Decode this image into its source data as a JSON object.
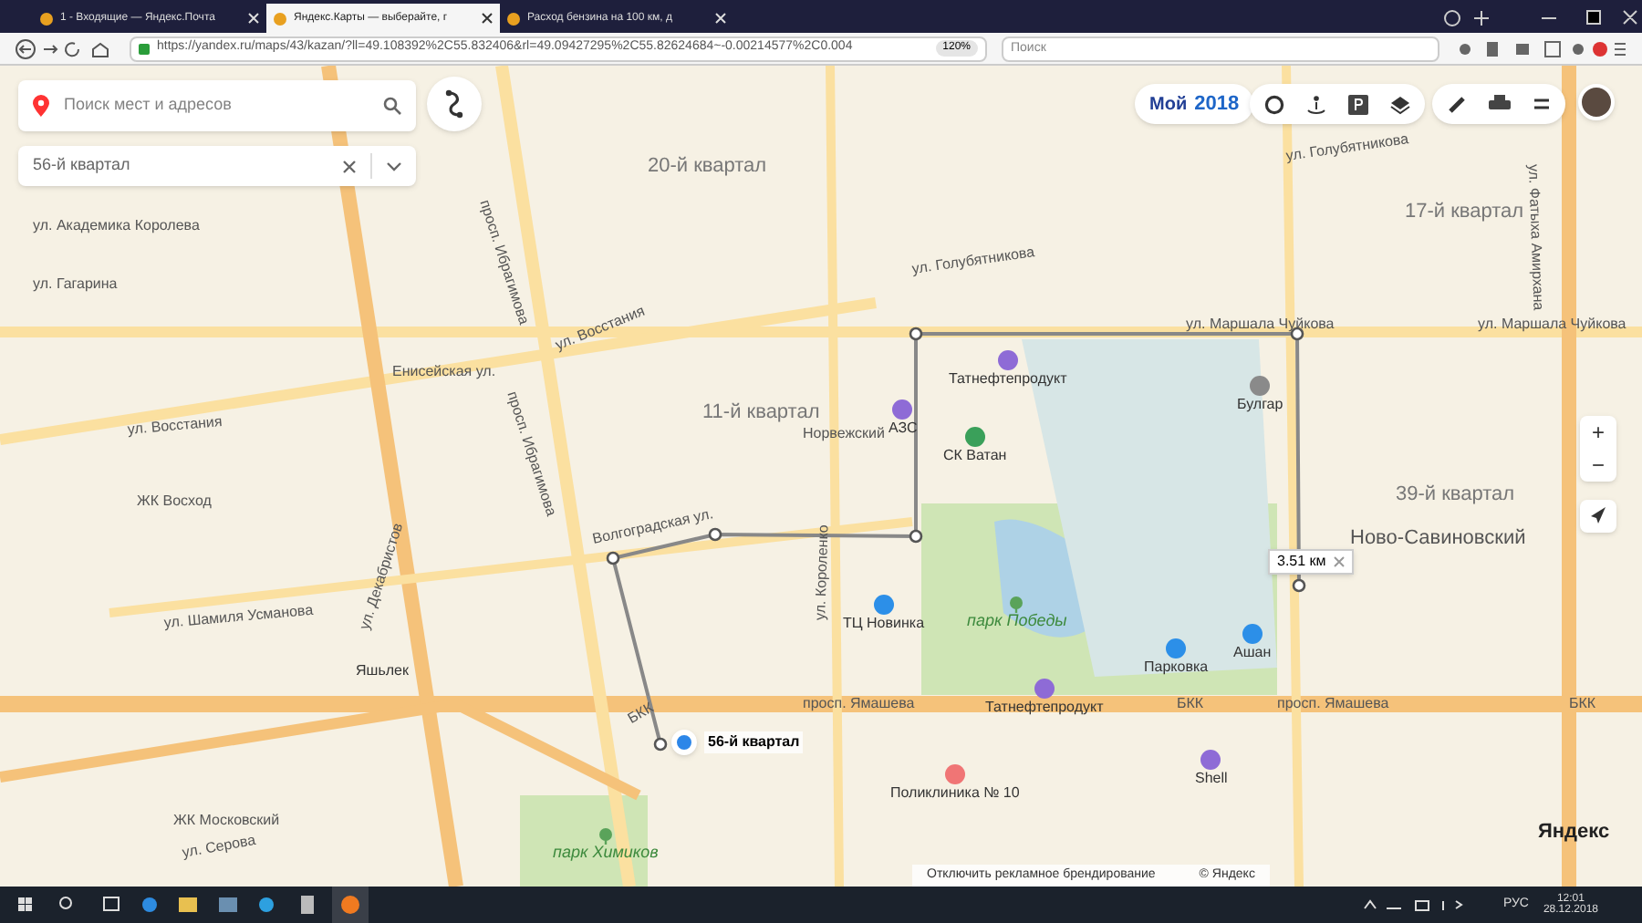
{
  "browser": {
    "tabs": [
      {
        "label": "1 - Входящие — Яндекс.Почта",
        "selected": false
      },
      {
        "label": "Яндекс.Карты — выберайте, г",
        "selected": true
      },
      {
        "label": "Расход бензина на 100 км, д",
        "selected": false
      }
    ],
    "url": "https://yandex.ru/maps/43/kazan/?ll=49.108392%2C55.832406&rl=49.09427295%2C55.82624684~-0.00214577%2C0.004",
    "zoom": "120%",
    "search_placeholder": "Поиск"
  },
  "map": {
    "search": {
      "placeholder": "Поиск мест и адресов"
    },
    "route_field": {
      "value": "56-й квартал"
    },
    "promo": {
      "word": "Мой",
      "year": "2018"
    },
    "labels": [
      {
        "text": "20-й квартал",
        "kind": "district"
      },
      {
        "text": "17-й квартал",
        "kind": "district"
      },
      {
        "text": "ул. Академика Королева",
        "kind": "street"
      },
      {
        "text": "ул. Голубятникова",
        "kind": "street"
      },
      {
        "text": "ул. Голубятникова",
        "kind": "street"
      },
      {
        "text": "ул. Гагарина",
        "kind": "street"
      },
      {
        "text": "ул. Маршала Чуйкова",
        "kind": "street"
      },
      {
        "text": "ул. Маршала Чуйкова",
        "kind": "street"
      },
      {
        "text": "ул. Восстания",
        "kind": "street"
      },
      {
        "text": "ул. Восстания",
        "kind": "street"
      },
      {
        "text": "Енисейская ул.",
        "kind": "street"
      },
      {
        "text": "11-й квартал",
        "kind": "district"
      },
      {
        "text": "Норвежский",
        "kind": "street"
      },
      {
        "text": "39-й квартал",
        "kind": "district"
      },
      {
        "text": "Ново-Савиновский",
        "kind": "area"
      },
      {
        "text": "Волгоградская ул.",
        "kind": "street"
      },
      {
        "text": "ЖК Восход",
        "kind": "street"
      },
      {
        "text": "ул. Шамиля Усманова",
        "kind": "street"
      },
      {
        "text": "ул. Декабристов",
        "kind": "street"
      },
      {
        "text": "просп. Ибрагимова",
        "kind": "street"
      },
      {
        "text": "просп. Ибрагимова",
        "kind": "street"
      },
      {
        "text": "ул. Короленко",
        "kind": "street"
      },
      {
        "text": "ул. Фатыха Амирхана",
        "kind": "street"
      },
      {
        "text": "просп. Ямашева",
        "kind": "street"
      },
      {
        "text": "БКК",
        "kind": "street"
      },
      {
        "text": "просп. Ямашева",
        "kind": "street"
      },
      {
        "text": "БКК",
        "kind": "street"
      },
      {
        "text": "БКК",
        "kind": "street"
      },
      {
        "text": "ЖК Московский",
        "kind": "street"
      },
      {
        "text": "ул. Серова",
        "kind": "street"
      },
      {
        "text": "Татнефтепродукт",
        "kind": "poi"
      },
      {
        "text": "АЗС",
        "kind": "poi"
      },
      {
        "text": "СК Ватан",
        "kind": "poi"
      },
      {
        "text": "Булгар",
        "kind": "poi"
      },
      {
        "text": "ТЦ Новинка",
        "kind": "poi"
      },
      {
        "text": "Татнефтепродукт",
        "kind": "poi"
      },
      {
        "text": "Парковка",
        "kind": "poi"
      },
      {
        "text": "Ашан",
        "kind": "poi"
      },
      {
        "text": "Shell",
        "kind": "poi"
      },
      {
        "text": "Поликлиника № 10",
        "kind": "poi"
      },
      {
        "text": "Яшьлек",
        "kind": "poi"
      },
      {
        "text": "парк Победы",
        "kind": "park"
      },
      {
        "text": "парк Химиков",
        "kind": "park"
      }
    ],
    "distance": "3.51 км",
    "route_point": "56-й квартал",
    "zoom_in": "+",
    "zoom_out": "−",
    "branding_link": "Отключить рекламное брендирование",
    "copyright": "© Яндекс",
    "logo": "Яндекс"
  },
  "taskbar": {
    "language": "РУС",
    "time": "12:01",
    "date": "28.12.2018"
  }
}
